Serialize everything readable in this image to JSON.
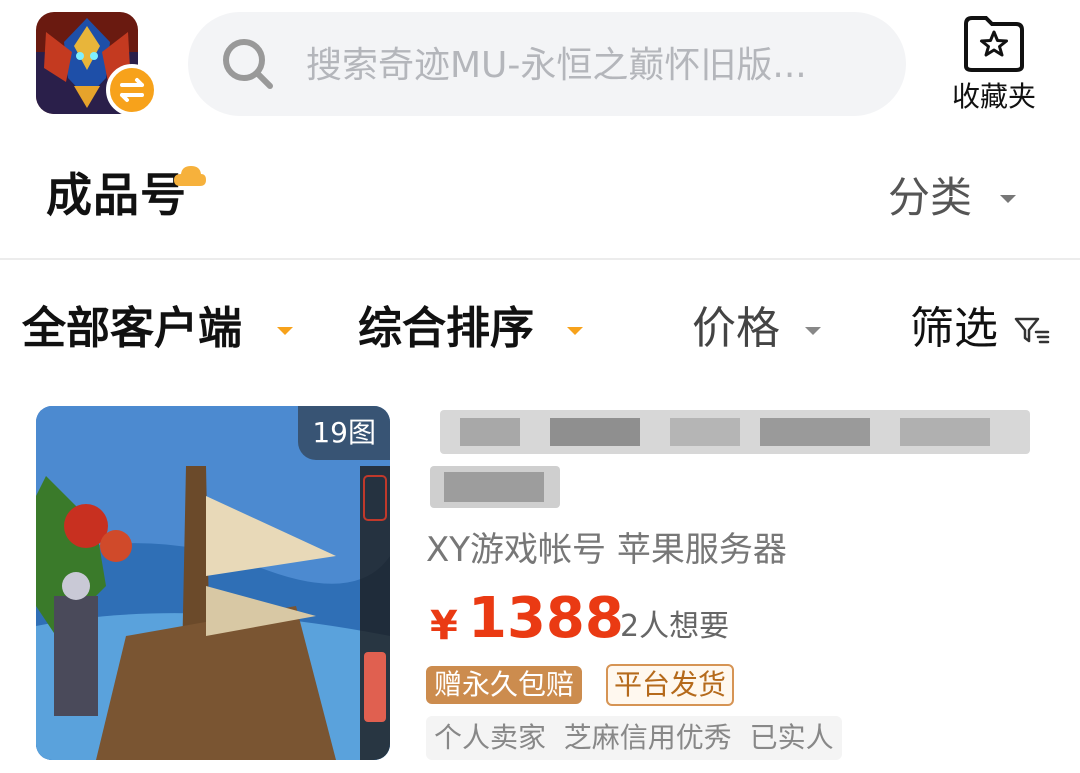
{
  "header": {
    "app_icon": "game-app-icon",
    "search": {
      "placeholder": "搜索奇迹MU-永恒之巅怀旧版..."
    },
    "favorites_label": "收藏夹"
  },
  "section": {
    "title": "成品号",
    "category_label": "分类"
  },
  "filters": {
    "client": "全部客户端",
    "sort": "综合排序",
    "price": "价格",
    "filter": "筛选"
  },
  "listing": {
    "image_count": "19图",
    "seller_info": "XY游戏帐号 苹果服务器",
    "currency": "¥",
    "price": "1388",
    "want_count": "2人想要",
    "tags": [
      "赠永久包赔",
      "平台发货"
    ],
    "seller_tags": "个人卖家  芝麻信用优秀  已实人"
  },
  "colors": {
    "accent_orange": "#f7a21b",
    "price_red": "#ea3a13",
    "tag_brown": "#cc8c4e"
  }
}
